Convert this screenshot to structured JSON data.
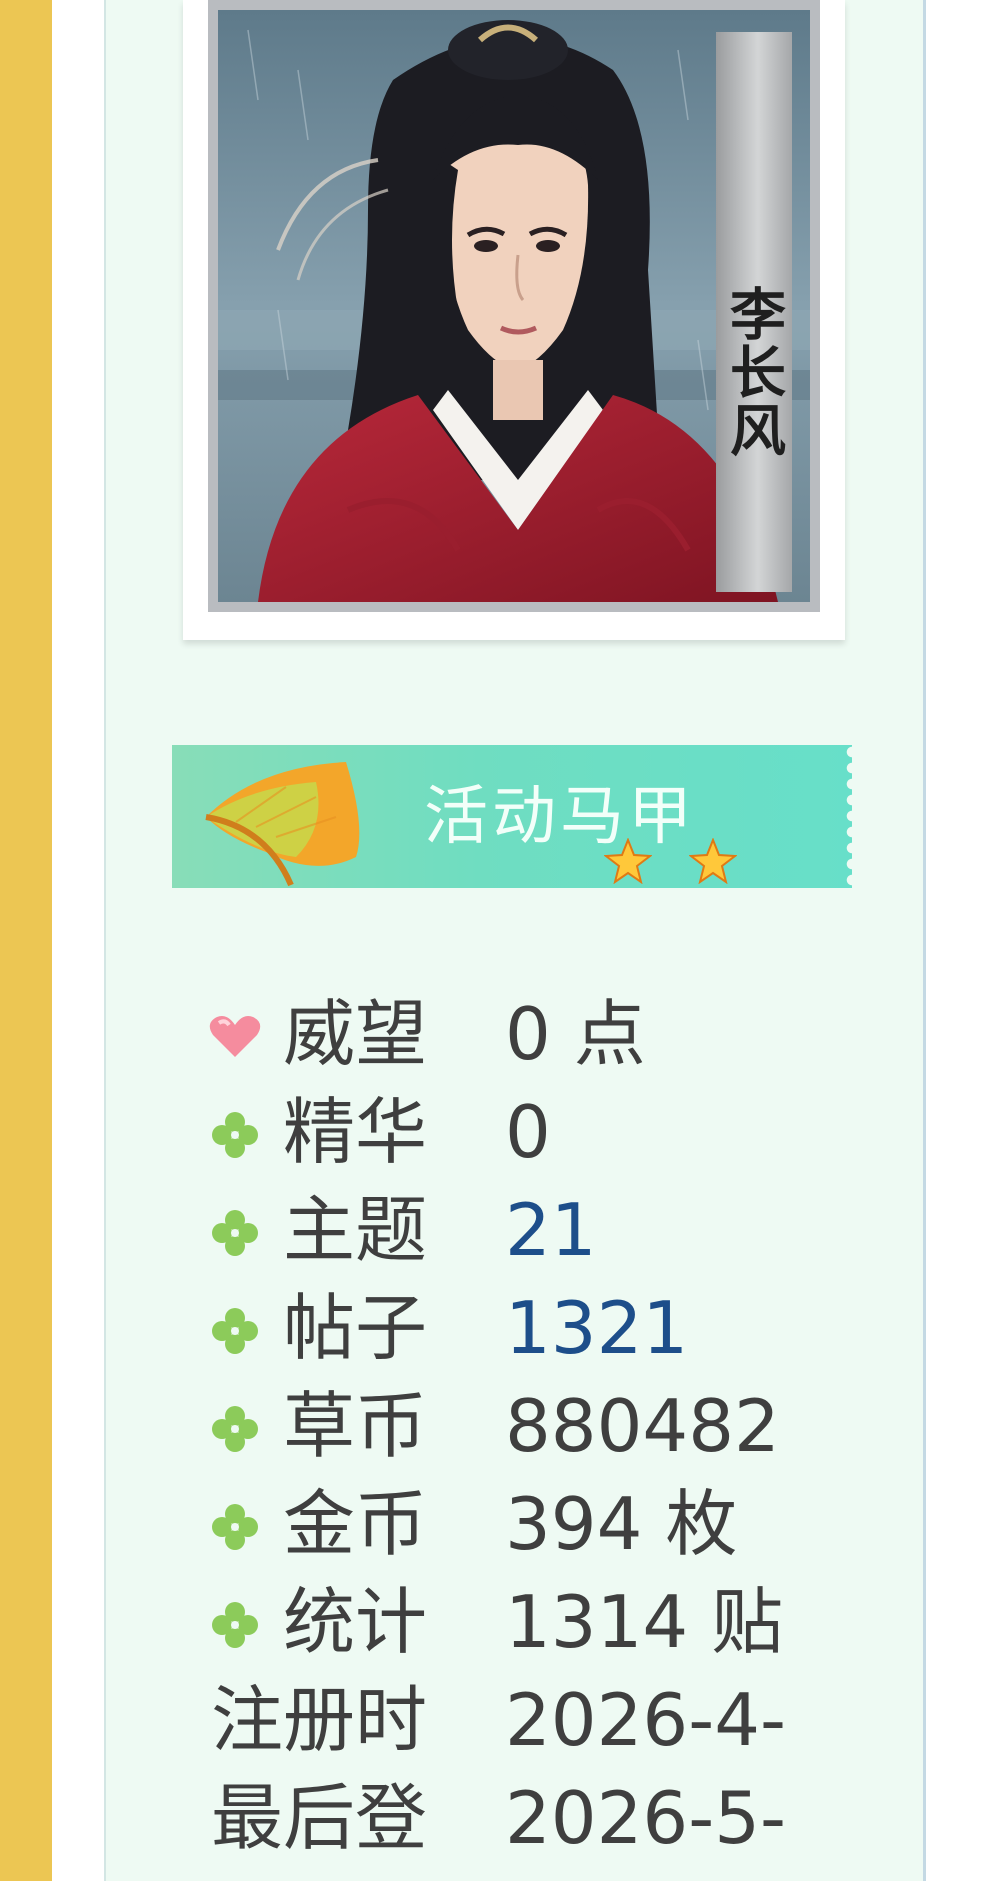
{
  "avatar": {
    "name_plate": "李长风"
  },
  "rank": {
    "title": "活动马甲",
    "stars": 2
  },
  "stats": [
    {
      "icon": "heart-icon",
      "label": "威望",
      "value": "0 点",
      "link": false
    },
    {
      "icon": "clover-icon",
      "label": "精华",
      "value": "0",
      "link": false
    },
    {
      "icon": "clover-icon",
      "label": "主题",
      "value": "21",
      "link": true
    },
    {
      "icon": "clover-icon",
      "label": "帖子",
      "value": "1321",
      "link": true
    },
    {
      "icon": "clover-icon",
      "label": "草币",
      "value": "880482",
      "link": false
    },
    {
      "icon": "clover-icon",
      "label": "金币",
      "value": "394 枚",
      "link": false
    },
    {
      "icon": "clover-icon",
      "label": "统计",
      "value": "1314 贴",
      "link": false
    },
    {
      "icon": "",
      "label": "注册时",
      "value": "2026-4-",
      "link": false
    },
    {
      "icon": "",
      "label": "最后登",
      "value": "2026-5-",
      "link": false
    }
  ],
  "colors": {
    "side_strip": "#ECC653",
    "panel_bg": "#EEFAF3",
    "badge_green": "#6FDDC1",
    "link_blue": "#1D4E8A",
    "text_gray": "#3F3F3F",
    "heart_pink": "#F07E92",
    "clover_green": "#8CCB5A"
  }
}
